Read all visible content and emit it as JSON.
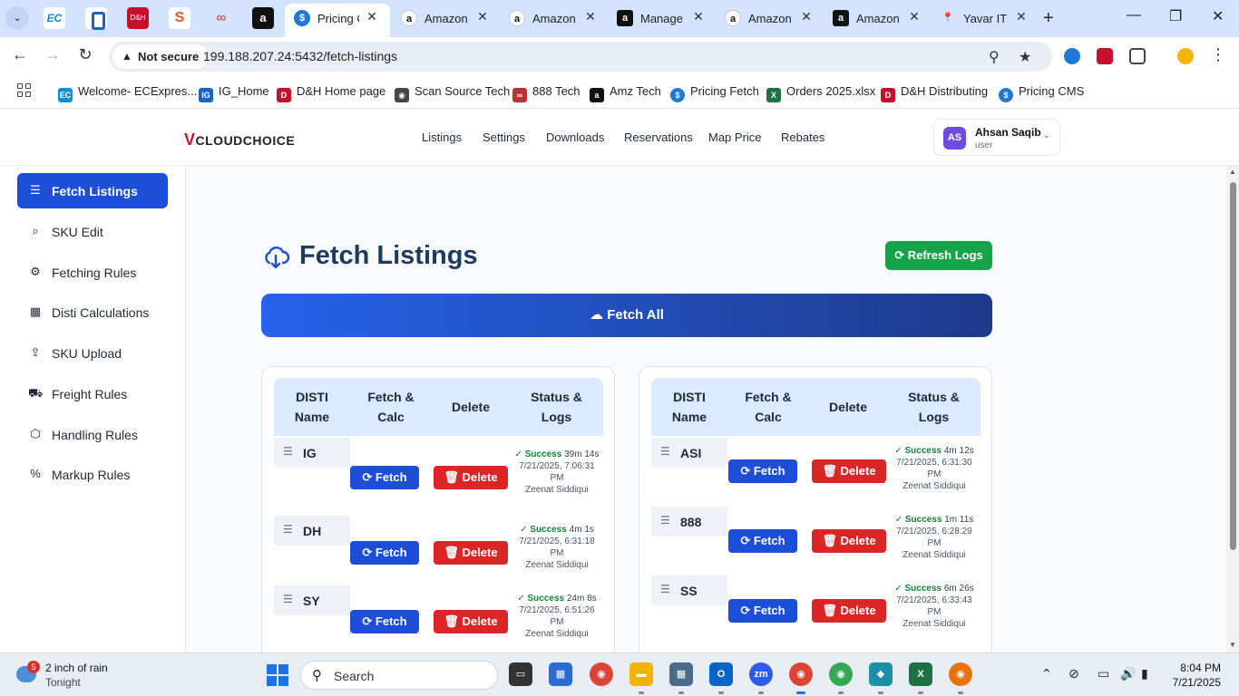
{
  "browser": {
    "tab_menu_icon": "chevron-down-icon",
    "pinned": [
      {
        "name": "ec-express",
        "text": "EC"
      },
      {
        "name": "ig",
        "text": ""
      },
      {
        "name": "dh",
        "text": "D&H"
      },
      {
        "name": "scansource",
        "text": "S"
      },
      {
        "name": "888",
        "text": "∞"
      },
      {
        "name": "amazon",
        "text": "a"
      }
    ],
    "tabs": [
      {
        "label": "Pricing C",
        "active": true,
        "icon_text": "$"
      },
      {
        "label": "Amazon",
        "active": false,
        "icon_text": "a"
      },
      {
        "label": "Amazon",
        "active": false,
        "icon_text": "a"
      },
      {
        "label": "Manage",
        "active": false,
        "icon_text": "a"
      },
      {
        "label": "Amazon",
        "active": false,
        "icon_text": "a"
      },
      {
        "label": "Amazon",
        "active": false,
        "icon_text": "a"
      },
      {
        "label": "Yavar IT",
        "active": false,
        "icon_text": "📍"
      }
    ],
    "new_tab": "+",
    "window": {
      "minimize": "—",
      "maximize": "❐",
      "close": "✕"
    },
    "not_secure": "Not secure",
    "url": "199.188.207.24:5432/fetch-listings",
    "bookmarks": [
      {
        "label": "Welcome- ECExpres...",
        "color": "#0b8fd6",
        "icon": "EC"
      },
      {
        "label": "IG_Home",
        "color": "#1665c0",
        "icon": "IG"
      },
      {
        "label": "D&H Home page",
        "color": "#c8102e",
        "icon": "D"
      },
      {
        "label": "Scan Source Tech",
        "color": "#444444",
        "icon": "◉"
      },
      {
        "label": "888 Tech",
        "color": "#b33333",
        "icon": "∞"
      },
      {
        "label": "Amz Tech",
        "color": "#111111",
        "icon": "a"
      },
      {
        "label": "Pricing Fetch",
        "color": "#1e78d7",
        "icon": "$"
      },
      {
        "label": "Orders 2025.xlsx",
        "color": "#1e7145",
        "icon": "X"
      },
      {
        "label": "D&H Distributing",
        "color": "#c8102e",
        "icon": "D"
      },
      {
        "label": "Pricing CMS",
        "color": "#1e78d7",
        "icon": "$"
      }
    ]
  },
  "app": {
    "logo": "CLOUDCHOICE",
    "logo_mark": "V",
    "nav": [
      "Listings",
      "Settings",
      "Downloads",
      "Reservations",
      "Map Price",
      "Rebates"
    ],
    "user": {
      "initials": "AS",
      "name": "Ahsan Saqib",
      "role": "user"
    },
    "sidebar": [
      {
        "label": "Fetch Listings",
        "icon": "list-icon",
        "glyph": "☰",
        "active": true
      },
      {
        "label": "SKU Edit",
        "icon": "search-icon",
        "glyph": "⌕",
        "active": false
      },
      {
        "label": "Fetching Rules",
        "icon": "gear-icon",
        "glyph": "⚙",
        "active": false
      },
      {
        "label": "Disti Calculations",
        "icon": "calculator-icon",
        "glyph": "▦",
        "active": false
      },
      {
        "label": "SKU Upload",
        "icon": "upload-icon",
        "glyph": "⇪",
        "active": false
      },
      {
        "label": "Freight Rules",
        "icon": "truck-icon",
        "glyph": "⛟",
        "active": false
      },
      {
        "label": "Handling Rules",
        "icon": "box-icon",
        "glyph": "⬡",
        "active": false
      },
      {
        "label": "Markup Rules",
        "icon": "percent-icon",
        "glyph": "%",
        "active": false
      }
    ],
    "page_title": "Fetch Listings",
    "refresh_label": "Refresh Logs",
    "fetch_all_label": "Fetch All",
    "table_headers": [
      "DISTI\nName",
      "Fetch &\nCalc",
      "Delete",
      "Status &\nLogs"
    ],
    "fetch_label": "Fetch",
    "delete_label": "Delete",
    "left_rows": [
      {
        "disti": "IG",
        "status": "Success",
        "duration": "39m 14s",
        "time": "7/21/2025, 7:06:31 PM",
        "user": "Zeenat Siddiqui"
      },
      {
        "disti": "DH",
        "status": "Success",
        "duration": "4m 1s",
        "time": "7/21/2025, 6:31:18 PM",
        "user": "Zeenat Siddiqui"
      },
      {
        "disti": "SY",
        "status": "Success",
        "duration": "24m 8s",
        "time": "7/21/2025, 6:51:26 PM",
        "user": "Zeenat Siddiqui"
      }
    ],
    "right_rows": [
      {
        "disti": "ASI",
        "status": "Success",
        "duration": "4m 12s",
        "time": "7/21/2025, 6:31:30 PM",
        "user": "Zeenat Siddiqui"
      },
      {
        "disti": "888",
        "status": "Success",
        "duration": "1m 11s",
        "time": "7/21/2025, 6:28:29 PM",
        "user": "Zeenat Siddiqui"
      },
      {
        "disti": "SS",
        "status": "Success",
        "duration": "6m 26s",
        "time": "7/21/2025, 6:33:43 PM",
        "user": "Zeenat Siddiqui"
      }
    ]
  },
  "taskbar": {
    "weather_badge": "5",
    "weather_title": "2 inch of rain",
    "weather_sub": "Tonight",
    "search_placeholder": "Search",
    "time": "8:04 PM",
    "date": "7/21/2025"
  },
  "colors": {
    "primary": "#1d4ed8",
    "success": "#16a34a",
    "danger": "#dc2626",
    "header_bg": "#dbeafe"
  }
}
